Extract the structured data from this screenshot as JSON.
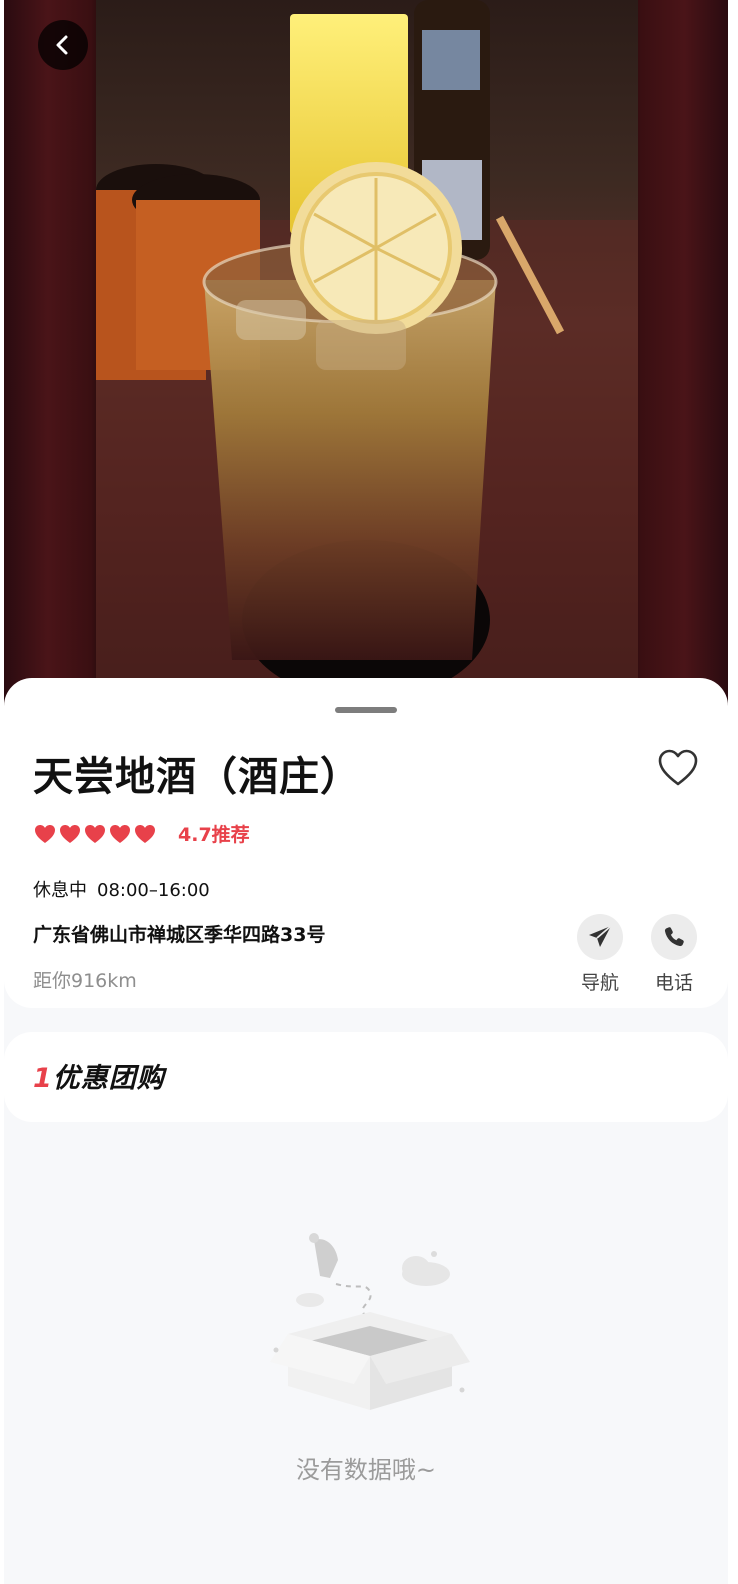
{
  "header": {
    "back_icon": "chevron-left-icon"
  },
  "shop": {
    "name": "天尝地酒（酒庄）",
    "rating_hearts": 5,
    "rating_text": "4.7推荐",
    "status": "休息中",
    "hours": "08:00–16:00",
    "address": "广东省佛山市禅城区季华四路33号",
    "distance": "距你916km",
    "favorite_icon": "heart-outline-icon"
  },
  "actions": {
    "navigate_label": "导航",
    "navigate_icon": "paper-plane-icon",
    "call_label": "电话",
    "call_icon": "phone-icon"
  },
  "deals": {
    "title_first_char": "1",
    "title_rest": "优惠团购"
  },
  "empty_state": {
    "text": "没有数据哦~",
    "illustration": "empty-box-icon"
  },
  "colors": {
    "accent": "#e8414a",
    "page_bg": "#f7f8fa",
    "card_bg": "#ffffff"
  }
}
